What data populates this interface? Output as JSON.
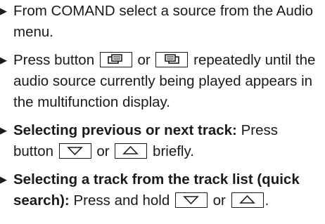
{
  "steps": [
    {
      "text": "From COMAND select a source from the Audio menu."
    },
    {
      "before": "Press button",
      "middle": "or",
      "after": "repeatedly until the audio source currently being played appears in the multifunction display.",
      "icons": [
        "display-back-icon",
        "display-forward-icon"
      ]
    },
    {
      "bold": "Selecting previous or next track:",
      "before": "Press button",
      "middle": "or",
      "after": "briefly.",
      "icons": [
        "arrow-down-icon",
        "arrow-up-icon"
      ]
    },
    {
      "bold": "Selecting a track from the track list (quick search):",
      "before": "Press and hold",
      "middle": "or",
      "after": ".",
      "icons": [
        "arrow-down-icon",
        "arrow-up-icon"
      ]
    }
  ]
}
